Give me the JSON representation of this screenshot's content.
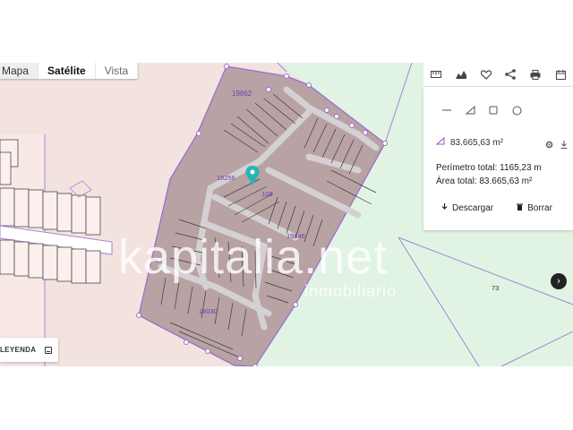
{
  "map_types": {
    "mapa": "Mapa",
    "satelite": "Satélite",
    "vista": "Vista",
    "active": "Satélite"
  },
  "legend": {
    "label": "LEYENDA"
  },
  "toolbar": {
    "icons": [
      "ruler-icon",
      "elevation-chart-icon",
      "heart-icon",
      "share-icon",
      "print-icon",
      "calendar-icon"
    ]
  },
  "draw_tools": [
    "line-tool",
    "polygon-tool",
    "rectangle-tool",
    "circle-tool"
  ],
  "measurement": {
    "area_value": "83.665,63 m²",
    "perimeter_label": "Perímetro total: 1165,23 m",
    "area_label": "Área total: 83.665,63 m²"
  },
  "actions": {
    "download": "Descargar",
    "delete": "Borrar"
  },
  "parcels": {
    "main": "19862",
    "a": "18256",
    "b": "108",
    "c": "19846",
    "d": "18030",
    "field": "73"
  },
  "watermark": {
    "brand": "kapitalia.net",
    "tagline": "inmobiliario"
  },
  "colors": {
    "land": "#f3e3df",
    "green_zone": "#e1f4e3",
    "parcel_fill": "#b9a2a3",
    "parcel_border": "#9a6fd0",
    "marker": "#2bb5b0",
    "road": "#d5d0d3"
  }
}
